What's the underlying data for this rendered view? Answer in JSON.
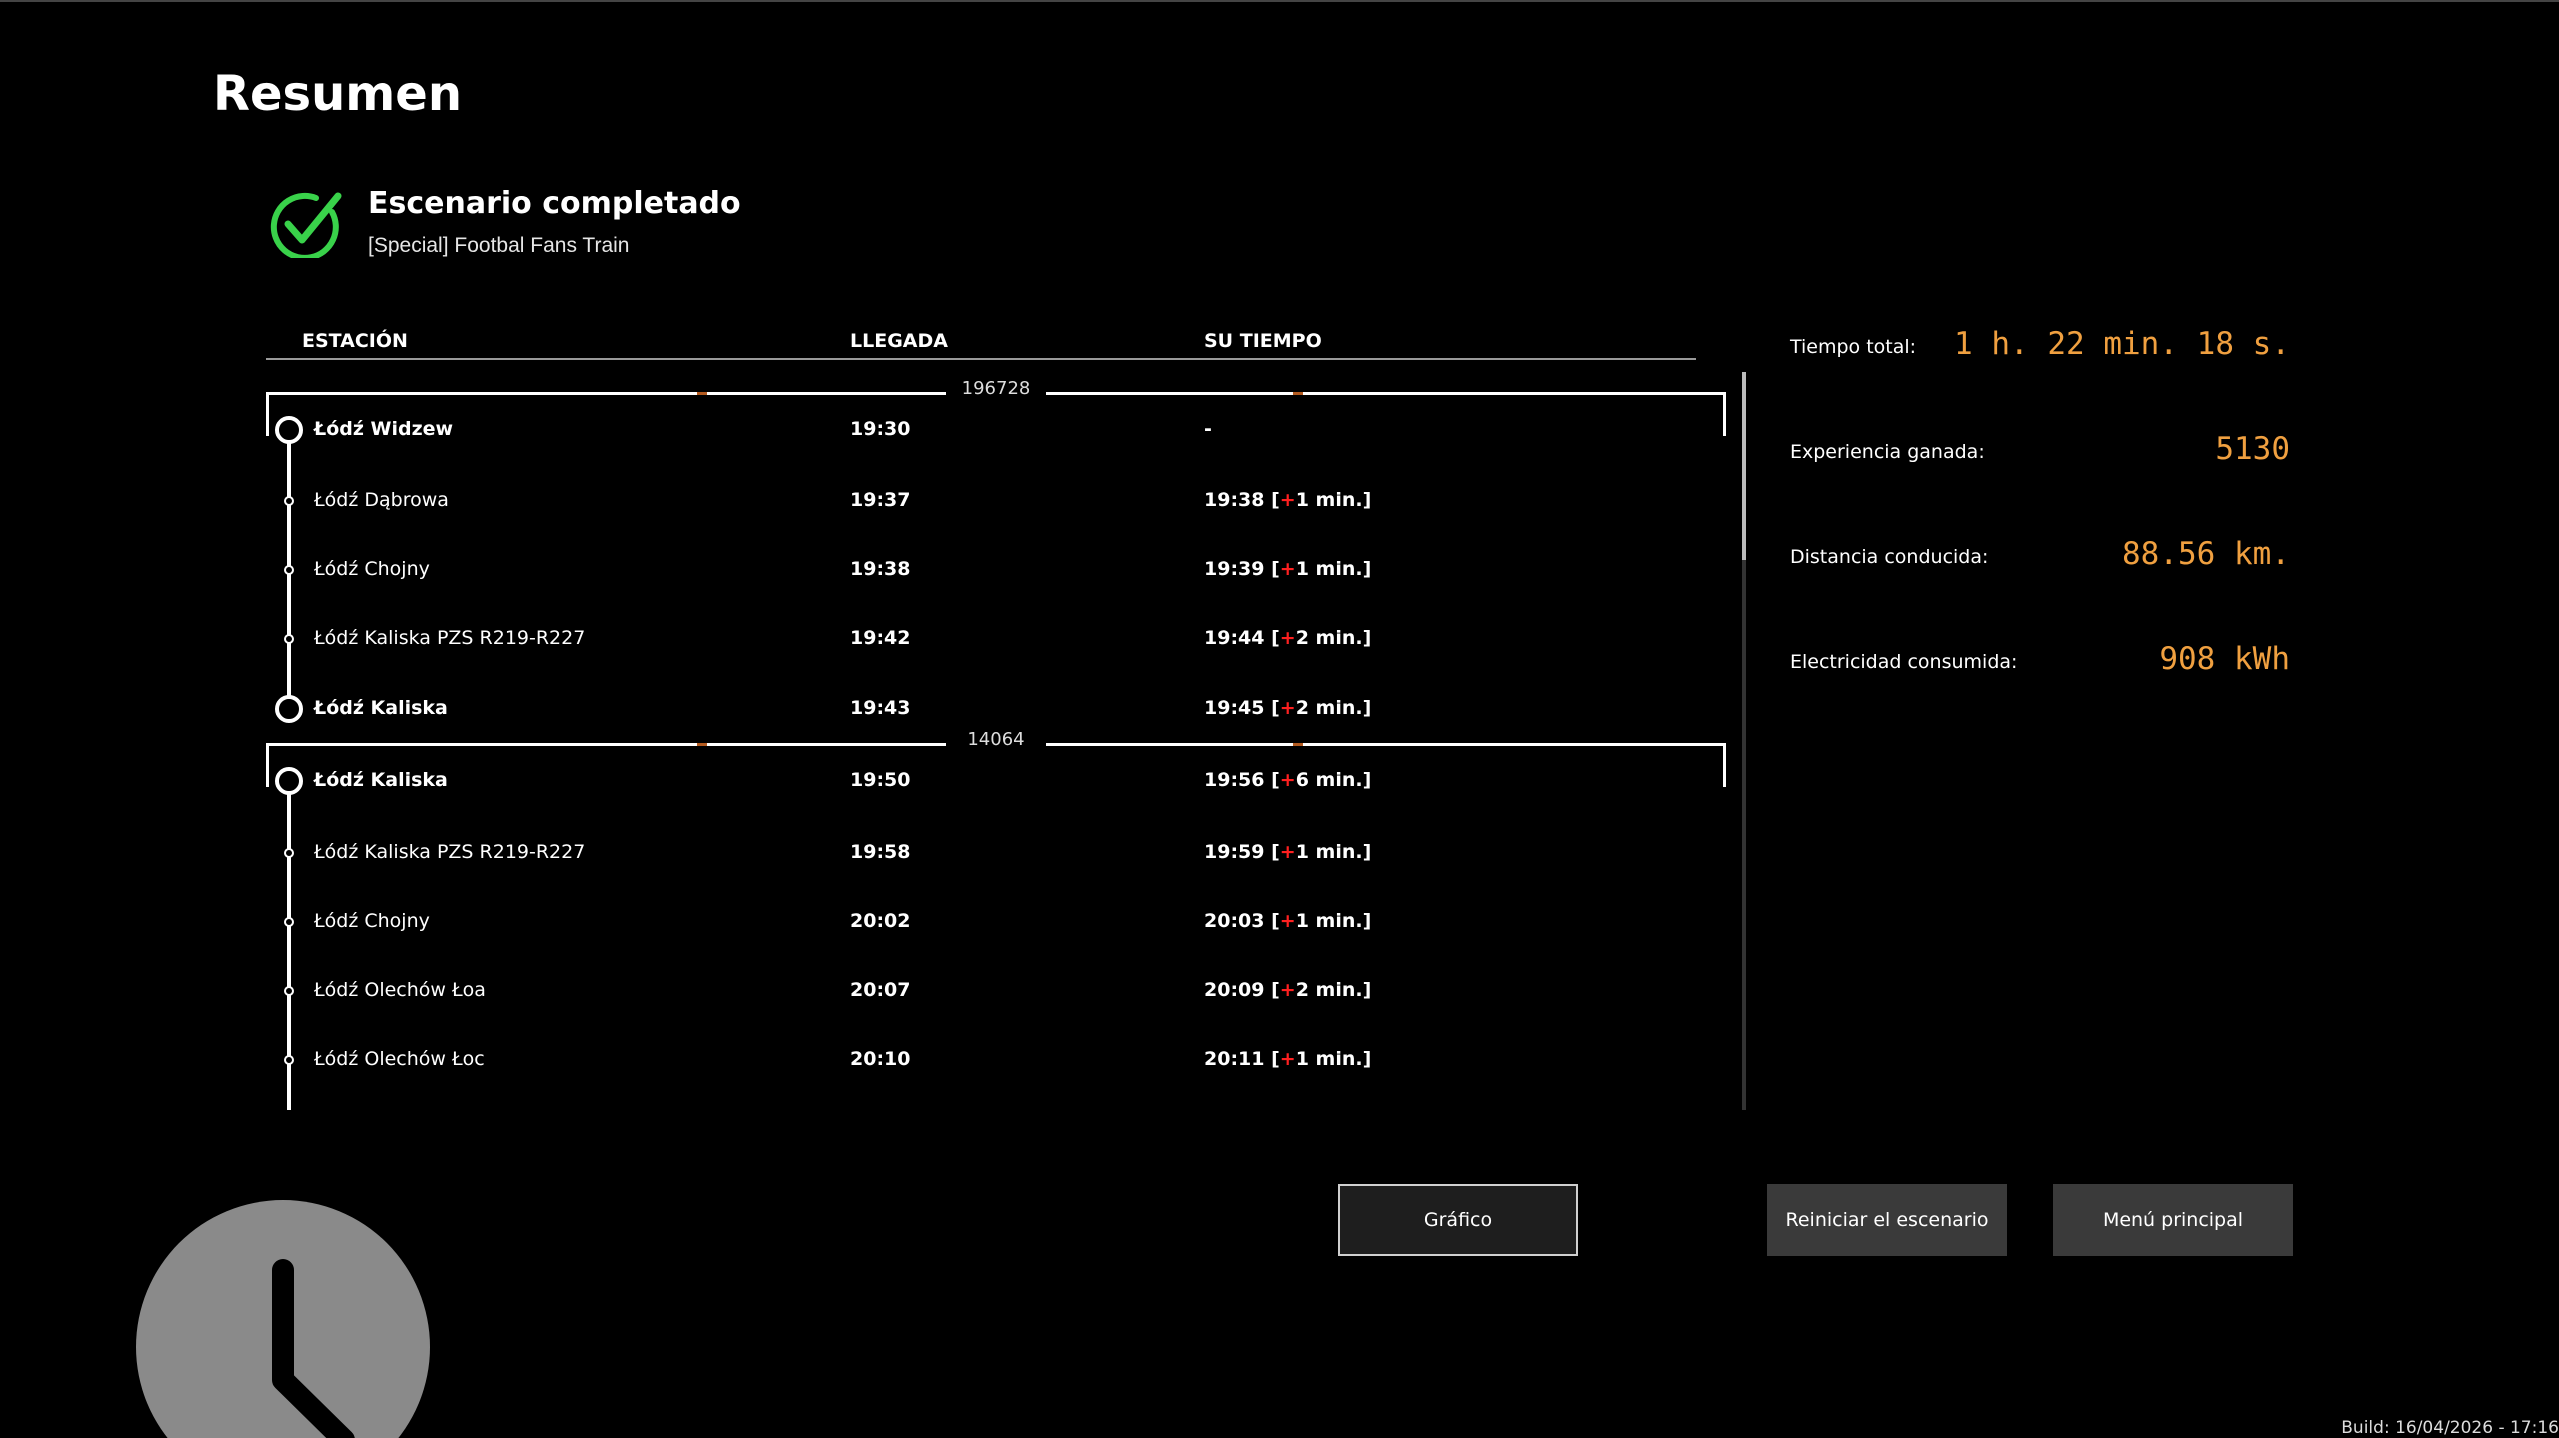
{
  "page": {
    "title": "Resumen"
  },
  "status": {
    "title": "Escenario completado",
    "scenario": "[Special] Footbal Fans Train",
    "icon": "check-icon",
    "color": "#39d24a"
  },
  "table": {
    "headers": {
      "station": "ESTACIÓN",
      "arrival": "LLEGADA",
      "your_time": "SU TIEMPO"
    },
    "groups": [
      {
        "train": "196728",
        "rows": [
          {
            "station": "Łódź Widzew",
            "arrival": "19:30",
            "time": "-",
            "delay": "",
            "major": true
          },
          {
            "station": "Łódź Dąbrowa",
            "arrival": "19:37",
            "time": "19:38 [",
            "delay": "1 min.]",
            "major": false
          },
          {
            "station": "Łódź Chojny",
            "arrival": "19:38",
            "time": "19:39 [",
            "delay": "1 min.]",
            "major": false
          },
          {
            "station": "Łódź Kaliska PZS R219-R227",
            "arrival": "19:42",
            "time": "19:44 [",
            "delay": "2 min.]",
            "major": false
          },
          {
            "station": "Łódź Kaliska",
            "arrival": "19:43",
            "time": "19:45 [",
            "delay": "2 min.]",
            "major": true
          }
        ]
      },
      {
        "train": "14064",
        "rows": [
          {
            "station": "Łódź Kaliska",
            "arrival": "19:50",
            "time": "19:56 [",
            "delay": "6 min.]",
            "major": true
          },
          {
            "station": "Łódź Kaliska PZS R219-R227",
            "arrival": "19:58",
            "time": "19:59 [",
            "delay": "1 min.]",
            "major": false
          },
          {
            "station": "Łódź Chojny",
            "arrival": "20:02",
            "time": "20:03 [",
            "delay": "1 min.]",
            "major": false
          },
          {
            "station": "Łódź Olechów Łoa",
            "arrival": "20:07",
            "time": "20:09 [",
            "delay": "2 min.]",
            "major": false
          },
          {
            "station": "Łódź Olechów Łoc",
            "arrival": "20:10",
            "time": "20:11 [",
            "delay": "1 min.]",
            "major": false
          }
        ]
      }
    ]
  },
  "stats": [
    {
      "label": "Tiempo total:",
      "value": "1 h. 22 min. 18 s."
    },
    {
      "label": "Experiencia ganada:",
      "value": "5130"
    },
    {
      "label": "Distancia conducida:",
      "value": "88.56 km."
    },
    {
      "label": "Electricidad consumida:",
      "value": "908 kWh"
    }
  ],
  "buttons": {
    "chart": "Gráfico",
    "restart": "Reiniciar el escenario",
    "main_menu": "Menú principal"
  },
  "footer": {
    "build": "Build: 16/04/2026 - 17:16"
  },
  "colors": {
    "accent": "#f0a040",
    "delay_plus": "#ff2020",
    "button_bg": "#3a3a3a"
  },
  "icons": {
    "clock": "clock-icon"
  }
}
